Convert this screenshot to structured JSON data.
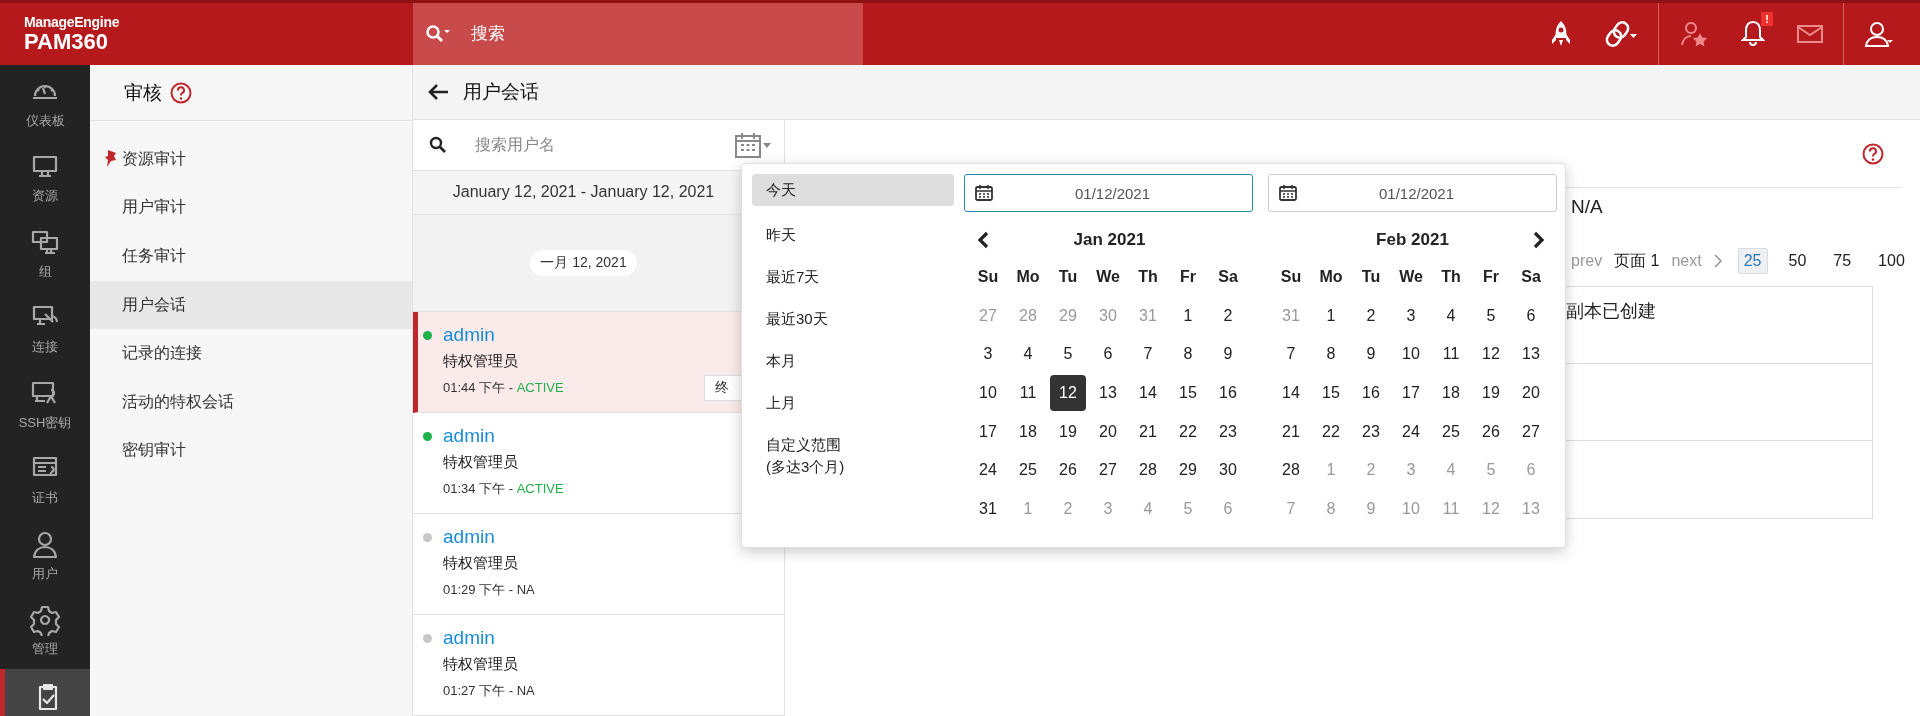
{
  "brand": {
    "vendor": "ManageEngine",
    "product": "PAM360"
  },
  "search": {
    "placeholder": "搜索"
  },
  "header": {
    "bell_badge": "!"
  },
  "nav": [
    {
      "label": "仪表板",
      "selected": false
    },
    {
      "label": "资源",
      "selected": false
    },
    {
      "label": "组",
      "selected": false
    },
    {
      "label": "连接",
      "selected": false
    },
    {
      "label": "SSH密钥",
      "selected": false
    },
    {
      "label": "证书",
      "selected": false
    },
    {
      "label": "用户",
      "selected": false
    },
    {
      "label": "管理",
      "selected": false
    },
    {
      "selected": true
    }
  ],
  "audit_menu": {
    "title": "审核",
    "items": [
      {
        "label": "资源审计",
        "pinned": true,
        "selected": false
      },
      {
        "label": "用户审计",
        "pinned": false,
        "selected": false
      },
      {
        "label": "任务审计",
        "pinned": false,
        "selected": false
      },
      {
        "label": "用户会话",
        "pinned": false,
        "selected": true
      },
      {
        "label": "记录的连接",
        "pinned": false,
        "selected": false
      },
      {
        "label": "活动的特权会话",
        "pinned": false,
        "selected": false
      },
      {
        "label": "密钥审计",
        "pinned": false,
        "selected": false
      }
    ]
  },
  "page": {
    "title": "用户会话"
  },
  "sessions": {
    "search_placeholder": "搜索用户名",
    "date_range": "January 12, 2021 - January 12, 2021",
    "group_date": "一月 12, 2021",
    "items": [
      {
        "user": "admin",
        "role": "特权管理员",
        "time": "01:44 下午 - ",
        "status": "ACTIVE",
        "active": true,
        "selected": true,
        "action": "终"
      },
      {
        "user": "admin",
        "role": "特权管理员",
        "time": "01:34 下午 - ",
        "status": "ACTIVE",
        "active": true,
        "selected": false
      },
      {
        "user": "admin",
        "role": "特权管理员",
        "time": "01:29 下午 - ",
        "status": "NA",
        "active": false,
        "selected": false
      },
      {
        "user": "admin",
        "role": "特权管理员",
        "time": "01:27 下午 - ",
        "status": "NA",
        "active": false,
        "selected": false
      }
    ]
  },
  "details": {
    "value": "N/A",
    "pager": {
      "prev": "prev",
      "page": "页面 1",
      "next": "next",
      "sizes": [
        {
          "label": "25",
          "selected": true
        },
        {
          "label": "50",
          "selected": false
        },
        {
          "label": "75",
          "selected": false
        },
        {
          "label": "100",
          "selected": false
        }
      ]
    },
    "rows": [
      {
        "text": "副本已创建"
      },
      {},
      {}
    ]
  },
  "date_picker": {
    "presets": [
      {
        "label": "今天",
        "selected": true
      },
      {
        "label": "昨天",
        "selected": false
      },
      {
        "label": "最近7天",
        "selected": false
      },
      {
        "label": "最近30天",
        "selected": false
      },
      {
        "label": "本月",
        "selected": false
      },
      {
        "label": "上月",
        "selected": false
      },
      {
        "label": "自定义范围",
        "note": "(多达3个月)",
        "selected": false
      }
    ],
    "inputs": [
      {
        "value": "01/12/2021",
        "focused": true
      },
      {
        "value": "01/12/2021",
        "focused": false
      }
    ],
    "months": [
      {
        "title": "Jan 2021",
        "weekdays": [
          "Su",
          "Mo",
          "Tu",
          "We",
          "Th",
          "Fr",
          "Sa"
        ],
        "days": [
          {
            "n": "27",
            "other": true,
            "selected": false
          },
          {
            "n": "28",
            "other": true,
            "selected": false
          },
          {
            "n": "29",
            "other": true,
            "selected": false
          },
          {
            "n": "30",
            "other": true,
            "selected": false
          },
          {
            "n": "31",
            "other": true,
            "selected": false
          },
          {
            "n": "1",
            "other": false,
            "selected": false
          },
          {
            "n": "2",
            "other": false,
            "selected": false
          },
          {
            "n": "3",
            "other": false,
            "selected": false
          },
          {
            "n": "4",
            "other": false,
            "selected": false
          },
          {
            "n": "5",
            "other": false,
            "selected": false
          },
          {
            "n": "6",
            "other": false,
            "selected": false
          },
          {
            "n": "7",
            "other": false,
            "selected": false
          },
          {
            "n": "8",
            "other": false,
            "selected": false
          },
          {
            "n": "9",
            "other": false,
            "selected": false
          },
          {
            "n": "10",
            "other": false,
            "selected": false
          },
          {
            "n": "11",
            "other": false,
            "selected": false
          },
          {
            "n": "12",
            "other": false,
            "selected": true
          },
          {
            "n": "13",
            "other": false,
            "selected": false
          },
          {
            "n": "14",
            "other": false,
            "selected": false
          },
          {
            "n": "15",
            "other": false,
            "selected": false
          },
          {
            "n": "16",
            "other": false,
            "selected": false
          },
          {
            "n": "17",
            "other": false,
            "selected": false
          },
          {
            "n": "18",
            "other": false,
            "selected": false
          },
          {
            "n": "19",
            "other": false,
            "selected": false
          },
          {
            "n": "20",
            "other": false,
            "selected": false
          },
          {
            "n": "21",
            "other": false,
            "selected": false
          },
          {
            "n": "22",
            "other": false,
            "selected": false
          },
          {
            "n": "23",
            "other": false,
            "selected": false
          },
          {
            "n": "24",
            "other": false,
            "selected": false
          },
          {
            "n": "25",
            "other": false,
            "selected": false
          },
          {
            "n": "26",
            "other": false,
            "selected": false
          },
          {
            "n": "27",
            "other": false,
            "selected": false
          },
          {
            "n": "28",
            "other": false,
            "selected": false
          },
          {
            "n": "29",
            "other": false,
            "selected": false
          },
          {
            "n": "30",
            "other": false,
            "selected": false
          },
          {
            "n": "31",
            "other": false,
            "selected": false
          },
          {
            "n": "1",
            "other": true,
            "selected": false
          },
          {
            "n": "2",
            "other": true,
            "selected": false
          },
          {
            "n": "3",
            "other": true,
            "selected": false
          },
          {
            "n": "4",
            "other": true,
            "selected": false
          },
          {
            "n": "5",
            "other": true,
            "selected": false
          },
          {
            "n": "6",
            "other": true,
            "selected": false
          }
        ]
      },
      {
        "title": "Feb 2021",
        "weekdays": [
          "Su",
          "Mo",
          "Tu",
          "We",
          "Th",
          "Fr",
          "Sa"
        ],
        "days": [
          {
            "n": "31",
            "other": true,
            "selected": false
          },
          {
            "n": "1",
            "other": false,
            "selected": false
          },
          {
            "n": "2",
            "other": false,
            "selected": false
          },
          {
            "n": "3",
            "other": false,
            "selected": false
          },
          {
            "n": "4",
            "other": false,
            "selected": false
          },
          {
            "n": "5",
            "other": false,
            "selected": false
          },
          {
            "n": "6",
            "other": false,
            "selected": false
          },
          {
            "n": "7",
            "other": false,
            "selected": false
          },
          {
            "n": "8",
            "other": false,
            "selected": false
          },
          {
            "n": "9",
            "other": false,
            "selected": false
          },
          {
            "n": "10",
            "other": false,
            "selected": false
          },
          {
            "n": "11",
            "other": false,
            "selected": false
          },
          {
            "n": "12",
            "other": false,
            "selected": false
          },
          {
            "n": "13",
            "other": false,
            "selected": false
          },
          {
            "n": "14",
            "other": false,
            "selected": false
          },
          {
            "n": "15",
            "other": false,
            "selected": false
          },
          {
            "n": "16",
            "other": false,
            "selected": false
          },
          {
            "n": "17",
            "other": false,
            "selected": false
          },
          {
            "n": "18",
            "other": false,
            "selected": false
          },
          {
            "n": "19",
            "other": false,
            "selected": false
          },
          {
            "n": "20",
            "other": false,
            "selected": false
          },
          {
            "n": "21",
            "other": false,
            "selected": false
          },
          {
            "n": "22",
            "other": false,
            "selected": false
          },
          {
            "n": "23",
            "other": false,
            "selected": false
          },
          {
            "n": "24",
            "other": false,
            "selected": false
          },
          {
            "n": "25",
            "other": false,
            "selected": false
          },
          {
            "n": "26",
            "other": false,
            "selected": false
          },
          {
            "n": "27",
            "other": false,
            "selected": false
          },
          {
            "n": "28",
            "other": false,
            "selected": false
          },
          {
            "n": "1",
            "other": true,
            "selected": false
          },
          {
            "n": "2",
            "other": true,
            "selected": false
          },
          {
            "n": "3",
            "other": true,
            "selected": false
          },
          {
            "n": "4",
            "other": true,
            "selected": false
          },
          {
            "n": "5",
            "other": true,
            "selected": false
          },
          {
            "n": "6",
            "other": true,
            "selected": false
          },
          {
            "n": "7",
            "other": true,
            "selected": false
          },
          {
            "n": "8",
            "other": true,
            "selected": false
          },
          {
            "n": "9",
            "other": true,
            "selected": false
          },
          {
            "n": "10",
            "other": true,
            "selected": false
          },
          {
            "n": "11",
            "other": true,
            "selected": false
          },
          {
            "n": "12",
            "other": true,
            "selected": false
          },
          {
            "n": "13",
            "other": true,
            "selected": false
          }
        ]
      }
    ]
  }
}
